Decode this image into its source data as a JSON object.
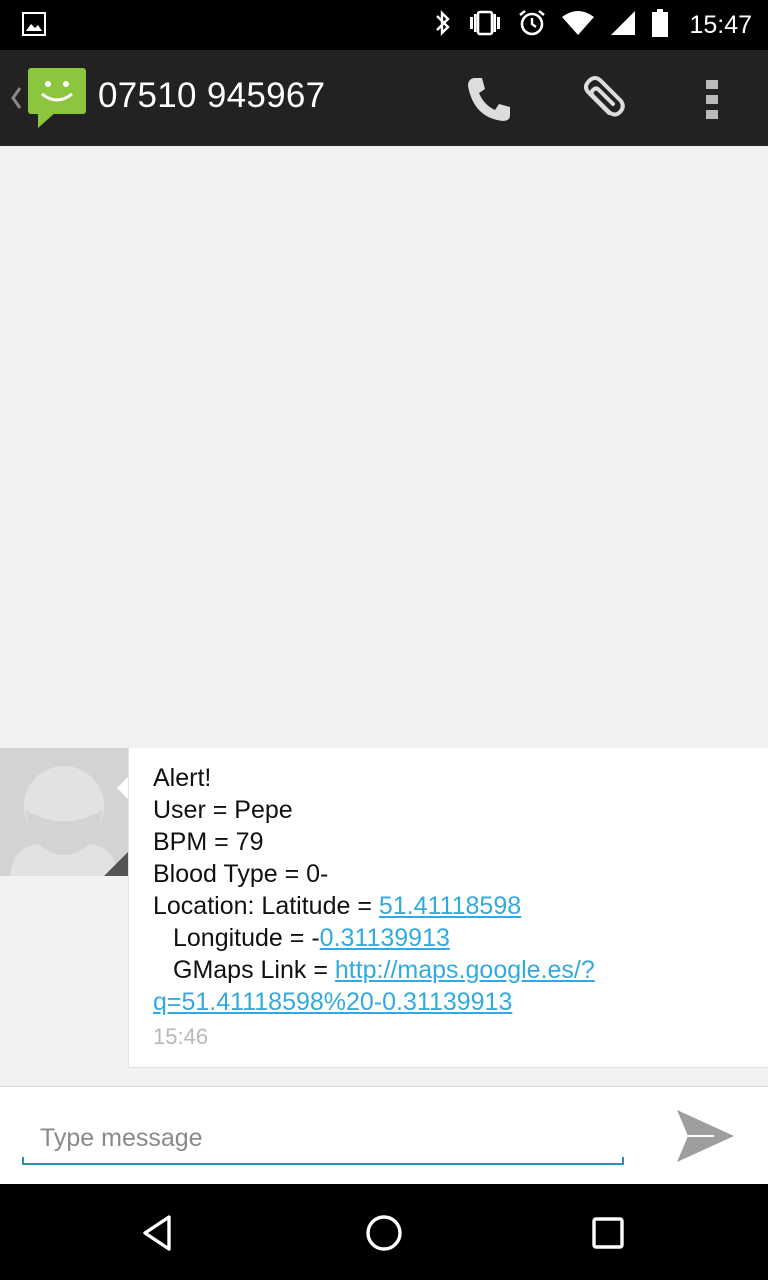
{
  "status_bar": {
    "time": "15:47",
    "icons": [
      "image-notification-icon",
      "bluetooth-icon",
      "vibrate-icon",
      "alarm-icon",
      "wifi-icon",
      "signal-icon",
      "battery-icon"
    ]
  },
  "action_bar": {
    "title": "07510 945967",
    "actions": [
      "phone-icon",
      "attach-icon",
      "overflow-menu-icon"
    ]
  },
  "message": {
    "lines": {
      "l1": "Alert!",
      "l2": "User = Pepe",
      "l3": "BPM = 79",
      "l4": "Blood Type = 0-",
      "l5_prefix": "Location: Latitude = ",
      "l5_link": "51.41118598",
      "l6_prefix": "Longitude = -",
      "l6_link": "0.31139913",
      "l7_prefix": "GMaps Link = ",
      "l7_link": "http://maps.google.es/?",
      "l8_link": "q=51.41118598%20-0.31139913"
    },
    "time": "15:46"
  },
  "compose": {
    "placeholder": "Type message"
  },
  "colors": {
    "link": "#33aadd",
    "app_icon_green": "#8cc63e",
    "compose_underline": "#2e8fb5"
  }
}
